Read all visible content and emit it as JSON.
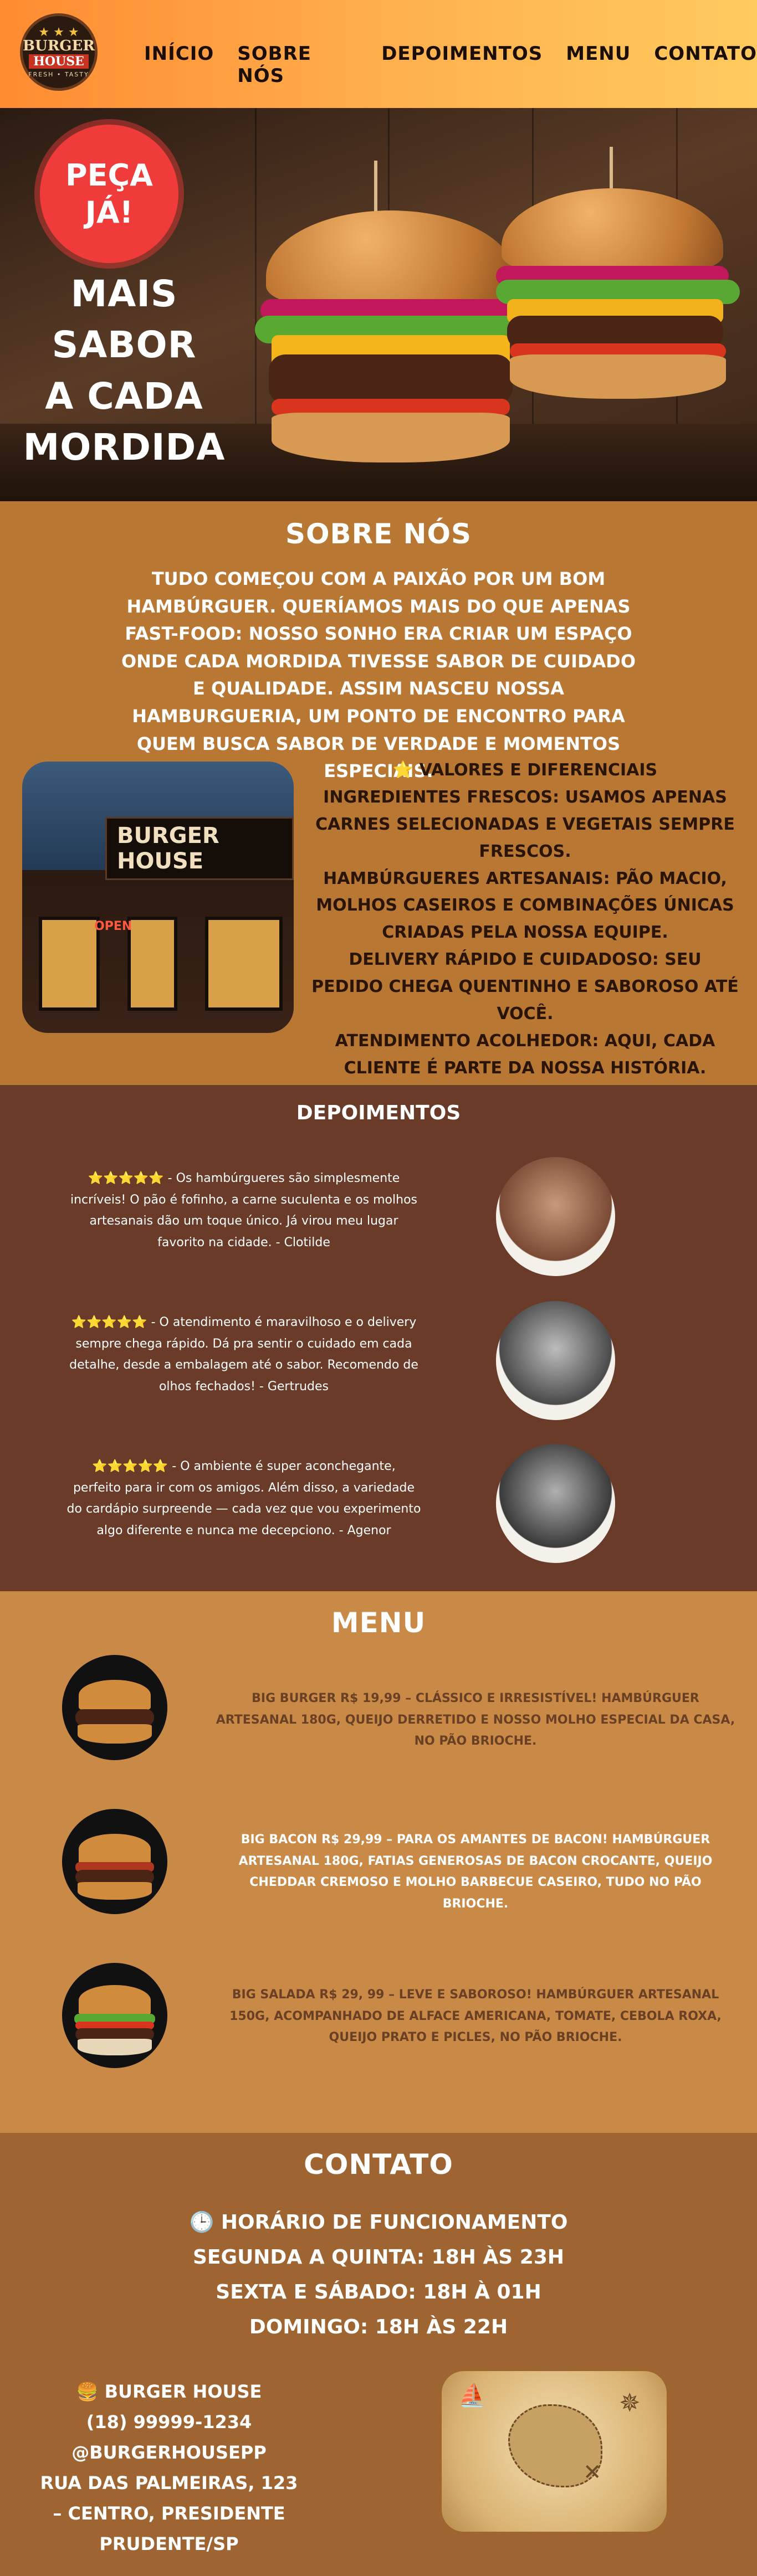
{
  "header": {
    "logo": {
      "top": "BURGER",
      "bottom": "HOUSE",
      "tagline": "FRESH • TASTY"
    },
    "nav": [
      "INÍCIO",
      "SOBRE NÓS",
      "DEPOIMENTOS",
      "MENU",
      "CONTATO"
    ]
  },
  "hero": {
    "badge_line1": "PEÇA",
    "badge_line2": "JÁ!",
    "slogan": [
      "MAIS SABOR",
      "A CADA",
      "MORDIDA"
    ]
  },
  "about": {
    "title": "SOBRE NÓS",
    "text": "TUDO COMEÇOU COM A PAIXÃO POR UM BOM HAMBÚRGUER. QUERÍAMOS MAIS DO QUE APENAS FAST-FOOD: NOSSO SONHO ERA CRIAR UM ESPAÇO ONDE CADA MORDIDA TIVESSE SABOR DE CUIDADO E QUALIDADE. ASSIM NASCEU NOSSA HAMBURGUERIA, UM PONTO DE ENCONTRO PARA QUEM BUSCA SABOR DE VERDADE E MOMENTOS ESPECIAIS.",
    "store_sign": "BURGER HOUSE",
    "store_open": "OPEN",
    "values_title": "⭐ VALORES E DIFERENCIAIS",
    "values": [
      "INGREDIENTES FRESCOS: USAMOS APENAS CARNES SELECIONADAS E VEGETAIS SEMPRE FRESCOS.",
      "HAMBÚRGUERES ARTESANAIS: PÃO MACIO, MOLHOS CASEIROS E COMBINAÇÕES ÚNICAS CRIADAS PELA NOSSA EQUIPE.",
      "DELIVERY RÁPIDO E CUIDADOSO: SEU PEDIDO CHEGA QUENTINHO E SABOROSO ATÉ VOCÊ.",
      "ATENDIMENTO ACOLHEDOR: AQUI, CADA CLIENTE É PARTE DA NOSSA HISTÓRIA."
    ]
  },
  "testimonials": {
    "title": "DEPOIMENTOS",
    "items": [
      {
        "stars": "⭐⭐⭐⭐⭐",
        "text": " - Os hambúrgueres são simplesmente incríveis! O pão é fofinho, a carne suculenta e os molhos artesanais dão um toque único. Já virou meu lugar favorito na cidade. - Clotilde"
      },
      {
        "stars": "⭐⭐⭐⭐⭐",
        "text": " - O atendimento é maravilhoso e o delivery sempre chega rápido. Dá pra sentir o cuidado em cada detalhe, desde a embalagem até o sabor. Recomendo de olhos fechados! - Gertrudes"
      },
      {
        "stars": "⭐⭐⭐⭐⭐",
        "text": " - O ambiente é super aconchegante, perfeito para ir com os amigos. Além disso, a variedade do cardápio surpreende — cada vez que vou experimento algo diferente e nunca me decepciono. - Agenor"
      }
    ]
  },
  "menu": {
    "title": "MENU",
    "items": [
      "BIG BURGER R$ 19,99 – CLÁSSICO E IRRESISTÍVEL! HAMBÚRGUER ARTESANAL 180G, QUEIJO DERRETIDO  E NOSSO MOLHO ESPECIAL DA CASA, NO PÃO BRIOCHE.",
      "BIG BACON R$ 29,99 – PARA OS AMANTES DE BACON! HAMBÚRGUER ARTESANAL 180G, FATIAS GENEROSAS DE BACON CROCANTE, QUEIJO CHEDDAR CREMOSO E MOLHO BARBECUE CASEIRO, TUDO NO PÃO BRIOCHE.",
      "BIG SALADA R$ 29, 99 – LEVE E SABOROSO! HAMBÚRGUER ARTESANAL 150G, ACOMPANHADO DE ALFACE AMERICANA, TOMATE, CEBOLA ROXA, QUEIJO PRATO E PICLES, NO PÃO BRIOCHE."
    ]
  },
  "contact": {
    "title": "CONTATO",
    "hours_title": "🕒 HORÁRIO DE FUNCIONAMENTO",
    "hours": [
      "SEGUNDA A QUINTA: 18H ÀS 23H",
      "SEXTA E SÁBADO: 18H À 01H",
      "DOMINGO: 18H ÀS 22H"
    ],
    "name": "🍔 BURGER HOUSE",
    "phone": "(18) 99999-1234",
    "social": "@BURGERHOUSEPP",
    "address": "RUA DAS PALMEIRAS, 123 – CENTRO, PRESIDENTE PRUDENTE/SP"
  }
}
